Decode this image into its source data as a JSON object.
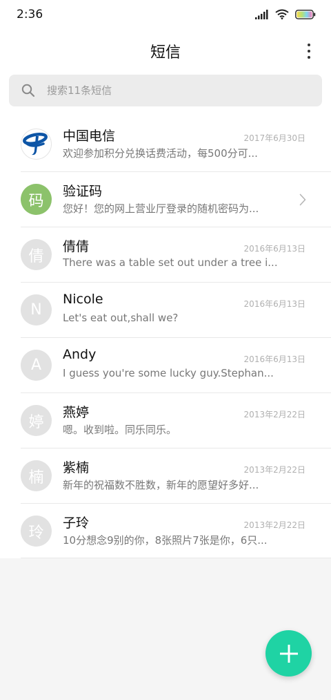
{
  "status_bar": {
    "time": "2:36",
    "icons": [
      "signal-icon",
      "wifi-icon",
      "battery-icon"
    ]
  },
  "header": {
    "title": "短信",
    "menu_icon": "more-vertical-icon"
  },
  "search": {
    "placeholder": "搜索11条短信",
    "icon": "search-icon"
  },
  "conversations": [
    {
      "name": "中国电信",
      "avatar_type": "logo",
      "avatar_icon": "china-telecom-logo",
      "date": "2017年6月30日",
      "preview": "欢迎参加积分兑换话费活动，每500分可..."
    },
    {
      "name": "验证码",
      "avatar_text": "码",
      "avatar_color": "#8cc26b",
      "date": "",
      "preview": "您好！您的网上营业厅登录的随机密码为...",
      "trailing_icon": "chevron-right-icon"
    },
    {
      "name": "倩倩",
      "avatar_text": "倩",
      "date": "2016年6月13日",
      "preview": "There was a table set out under a tree i..."
    },
    {
      "name": "Nicole",
      "avatar_text": "N",
      "date": "2016年6月13日",
      "preview": "Let's eat out,shall we?"
    },
    {
      "name": "Andy",
      "avatar_text": "A",
      "date": "2016年6月13日",
      "preview": "I guess you're some lucky guy.Stephan..."
    },
    {
      "name": "燕婷",
      "avatar_text": "婷",
      "date": "2013年2月22日",
      "preview": "嗯。收到啦。同乐同乐。"
    },
    {
      "name": "紫楠",
      "avatar_text": "楠",
      "date": "2013年2月22日",
      "preview": "新年的祝福数不胜数，新年的愿望好多好..."
    },
    {
      "name": "子玲",
      "avatar_text": "玲",
      "date": "2013年2月22日",
      "preview": "10分想念9别的你，8张照片7张是你，6只..."
    }
  ],
  "fab": {
    "icon": "plus-icon",
    "color": "#1fd3a4"
  },
  "colors": {
    "accent": "#1fd3a4",
    "avatar_default": "#e2e2e2",
    "avatar_green": "#8cc26b",
    "telecom_blue": "#0d55a6"
  }
}
